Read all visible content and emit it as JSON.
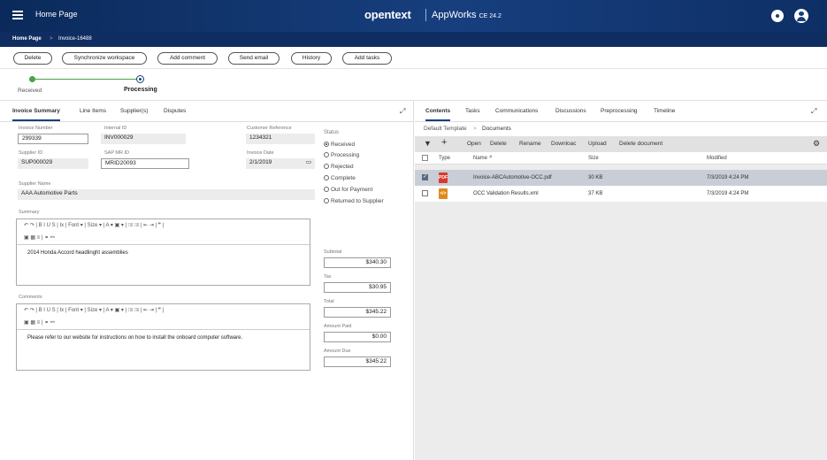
{
  "header": {
    "title": "Home Page",
    "brand": "opentext",
    "app_name": "AppWorks",
    "app_version": "CE 24.2"
  },
  "breadcrumb": {
    "home": "Home Page",
    "separator": ">",
    "current": "Invoice-16488"
  },
  "actions": {
    "delete": "Delete",
    "sync": "Synchronize workspace",
    "add_comment": "Add comment",
    "send_email": "Send email",
    "history": "History",
    "add_tasks": "Add tasks"
  },
  "workflow": {
    "step1": "Received",
    "step2": "Processing"
  },
  "left_tabs": {
    "invoice_summary": "Invoice Summary",
    "line_items": "Line Items",
    "suppliers": "Supplier(s)",
    "disputes": "Disputes"
  },
  "form": {
    "invoice_number_label": "Invoice Number",
    "invoice_number": "299339",
    "internal_id_label": "Internal ID",
    "internal_id": "INV000029",
    "customer_ref_label": "Customer Reference",
    "customer_ref": "1234321",
    "supplier_id_label": "Supplier ID",
    "supplier_id": "SUP000029",
    "sap_mr_id_label": "SAP MR ID",
    "sap_mr_id": "MRID20093",
    "invoice_date_label": "Invoice Date",
    "invoice_date": "2/1/2019",
    "supplier_name_label": "Supplier Name",
    "supplier_name": "AAA Automotive Parts",
    "summary_label": "Summary",
    "summary_text": "2014 Honda Accord headlinght assemblies",
    "comments_label": "Comments",
    "comments_text": "Please refer to our website for instructions on how to install the onboard computer software."
  },
  "editor_toolbar": {
    "row1": "↶  ↷  |  B   I   U   S  |  Ix  |  Font    ▾  |  Size    ▾  |  A ▾  ▣ ▾  |  ⁝≡  ⁝≡  |  ⇤  ⇥  |  ❞  |",
    "row2": "▣  ▦  ≡  |  ⚭  ⚯"
  },
  "status": {
    "label": "Status",
    "options": [
      "Received",
      "Processing",
      "Rejected",
      "Complete",
      "Out for Payment",
      "Returned to Supplier"
    ],
    "selected": "Received"
  },
  "amounts": {
    "subtotal_label": "Subtotal",
    "subtotal": "$340.30",
    "tax_label": "Tax",
    "tax": "$30.95",
    "total_label": "Total",
    "total": "$345.22",
    "amount_paid_label": "Amount Paid",
    "amount_paid": "$0.00",
    "amount_due_label": "Amount Due",
    "amount_due": "$345.22"
  },
  "right_tabs": {
    "contents": "Contents",
    "tasks": "Tasks",
    "communications": "Communications",
    "discussions": "Discussions",
    "preprocessing": "Preprocessing",
    "timeline": "Timeline"
  },
  "doc_crumb": {
    "template": "Default Template",
    "sep": ">",
    "folder": "Documents"
  },
  "doc_toolbar": {
    "add": "+",
    "open": "Open",
    "delete": "Delete",
    "rename": "Rename",
    "download": "Downloac",
    "upload": "Upload",
    "delete_document": "Delete document"
  },
  "columns": {
    "type": "Type",
    "name": "Name",
    "size": "Size",
    "modified": "Modified"
  },
  "documents": [
    {
      "type": "pdf",
      "name": "Invoice-ABCAutomotive-OCC.pdf",
      "size": "30 KB",
      "modified": "7/3/2019 4:24 PM",
      "selected": true
    },
    {
      "type": "xml",
      "name": "OCC Validation Results.xml",
      "size": "37 KB",
      "modified": "7/3/2019 4:24 PM",
      "selected": false
    }
  ],
  "colors": {
    "header_bg": "#173f7e",
    "pdf_icon": "#d9392b",
    "xml_icon": "#e08a1e",
    "workflow_done": "#49a14b"
  }
}
